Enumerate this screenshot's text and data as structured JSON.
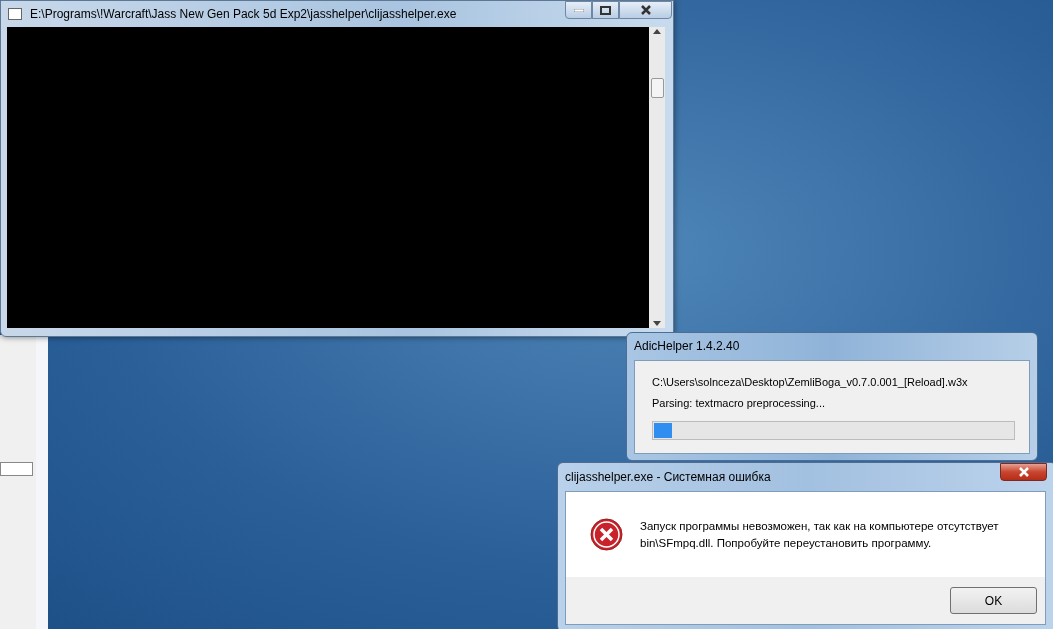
{
  "console_window": {
    "title": "E:\\Programs\\!Warcraft\\Jass New Gen Pack 5d Exp2\\jasshelper\\clijasshelper.exe"
  },
  "progress_window": {
    "title": "AdicHelper 1.4.2.40",
    "file_path": "C:\\Users\\solnceza\\Desktop\\ZemliBoga_v0.7.0.001_[Reload].w3x",
    "status": "Parsing: textmacro preprocessing...",
    "level": 0.05
  },
  "error_dialog": {
    "title": "clijasshelper.exe - Системная ошибка",
    "message": "Запуск программы невозможен, так как на компьютере отсутствует bin\\SFmpq.dll. Попробуйте переустановить программу.",
    "buttons": [
      "OK"
    ]
  }
}
